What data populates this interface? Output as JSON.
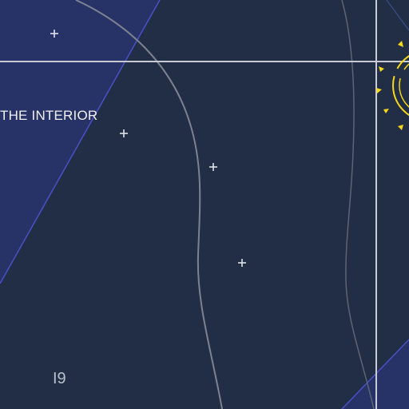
{
  "map": {
    "region_label": "THE INTERIOR",
    "grid_code": "I9",
    "colors": {
      "background": "#222e45",
      "zone_fill": "#273366",
      "zone_edge": "#4a50c8",
      "grid_line": "#c9cad6",
      "contour": "#7d8290",
      "marker": "#dfe2ea",
      "beacon": "#f5d71c",
      "label": "#f0f0f4"
    },
    "icons": {
      "marker": "plus-marker-icon",
      "beacon": "sun-beacon-icon"
    }
  }
}
